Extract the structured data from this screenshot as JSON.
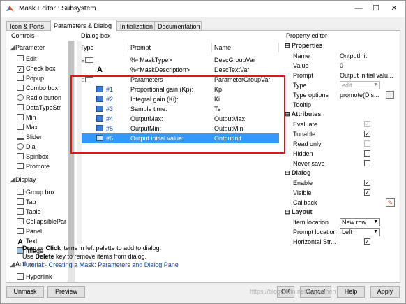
{
  "window": {
    "title": "Mask Editor : Subsystem",
    "min": "—",
    "max": "☐",
    "close": "✕"
  },
  "tabs": [
    "Icon & Ports",
    "Parameters & Dialog",
    "Initialization",
    "Documentation"
  ],
  "controls": {
    "title": "Controls",
    "parameter_header": "Parameter",
    "parameter_items": [
      "Edit",
      "Check box",
      "Popup",
      "Combo box",
      "Radio button",
      "DataTypeStr",
      "Min",
      "Max",
      "Slider",
      "Dial",
      "Spinbox",
      "Promote"
    ],
    "display_header": "Display",
    "display_items": [
      "Group box",
      "Tab",
      "Table",
      "CollapsiblePar",
      "Panel",
      "Text",
      "Image"
    ],
    "action_header": "Action",
    "action_items": [
      "Hyperlink"
    ]
  },
  "dialog_box": {
    "title": "Dialog box",
    "columns": [
      "Type",
      "Prompt",
      "Name"
    ],
    "rows": [
      {
        "type": "",
        "prompt": "%<MaskType>",
        "name": "DescGroupVar"
      },
      {
        "type": "A",
        "prompt": "%<MaskDescription>",
        "name": "DescTextVar"
      },
      {
        "type": "",
        "prompt": "Parameters",
        "name": "ParameterGroupVar"
      },
      {
        "type": "#1",
        "prompt": "Proportional gain (Kp):",
        "name": "Kp"
      },
      {
        "type": "#2",
        "prompt": "Integral gain (Ki):",
        "name": "Ki"
      },
      {
        "type": "#3",
        "prompt": "Sample time:",
        "name": "Ts"
      },
      {
        "type": "#4",
        "prompt": "OutputMax:",
        "name": "OutputMax"
      },
      {
        "type": "#5",
        "prompt": "OutputMin:",
        "name": "OutputMin"
      },
      {
        "type": "#6",
        "prompt": "Output initial value:",
        "name": "OntputInit"
      }
    ],
    "hint_line1_a": "Drag",
    "hint_line1_b": " or ",
    "hint_line1_c": "Click",
    "hint_line1_d": " items in left palette to add to dialog.",
    "hint_line2_a": "Use ",
    "hint_line2_b": "Delete",
    "hint_line2_c": " key to remove items from dialog.",
    "hint_link": "Tutorial:- Creating a Mask: Parameters and Dialog Pane"
  },
  "property_editor": {
    "title": "Property editor",
    "groups": {
      "properties": "Properties",
      "attributes": "Attributes",
      "dialog": "Dialog",
      "layout": "Layout"
    },
    "properties": [
      {
        "key": "Name",
        "value": "OntputInit"
      },
      {
        "key": "Value",
        "value": "0"
      },
      {
        "key": "Prompt",
        "value": "Output initial valu..."
      },
      {
        "key": "Type",
        "value": "edit"
      },
      {
        "key": "Type options",
        "value": "promote(Dis..."
      },
      {
        "key": "Tooltip",
        "value": ""
      }
    ],
    "attributes": [
      {
        "key": "Evaluate",
        "checked": true,
        "disabled": true
      },
      {
        "key": "Tunable",
        "checked": true,
        "disabled": false
      },
      {
        "key": "Read only",
        "checked": false,
        "disabled": true
      },
      {
        "key": "Hidden",
        "checked": false,
        "disabled": false
      },
      {
        "key": "Never save",
        "checked": false,
        "disabled": false
      }
    ],
    "dialog": [
      {
        "key": "Enable",
        "checked": true
      },
      {
        "key": "Visible",
        "checked": true
      },
      {
        "key": "Callback",
        "checked": false
      }
    ],
    "layout": [
      {
        "key": "Item location",
        "value": "New row"
      },
      {
        "key": "Prompt location",
        "value": "Left"
      },
      {
        "key": "Horizontal Str...",
        "checked": true
      }
    ]
  },
  "buttons": {
    "unmask": "Unmask",
    "preview": "Preview",
    "ok": "OK",
    "cancel": "Cancel",
    "help": "Help",
    "apply": "Apply"
  },
  "watermark": "https://blog.csdn.net/zy_wuhen",
  "colors": {
    "selection": "#3399ff",
    "highlight_box": "#e0151b",
    "link": "#0645ad"
  }
}
